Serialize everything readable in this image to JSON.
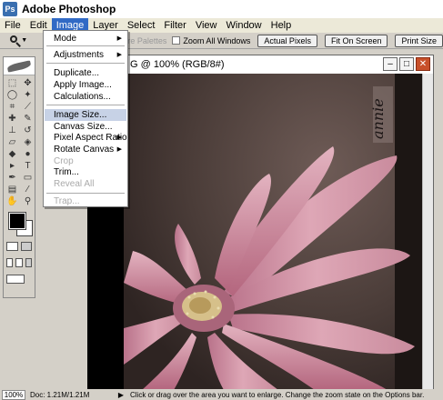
{
  "app": {
    "title": "Adobe Photoshop"
  },
  "menubar": {
    "items": [
      "File",
      "Edit",
      "Image",
      "Layer",
      "Select",
      "Filter",
      "View",
      "Window",
      "Help"
    ],
    "active": "Image"
  },
  "options": {
    "zoom_tool": "zoom-icon",
    "checkboxes": [
      {
        "label": "Ignore Palettes",
        "checked": false,
        "enabled": false
      },
      {
        "label": "Zoom All Windows",
        "checked": false,
        "enabled": true
      }
    ],
    "buttons": [
      "Actual Pixels",
      "Fit On Screen",
      "Print Size"
    ]
  },
  "document": {
    "title": "G @ 100% (RGB/8#)",
    "logo_text": "annie"
  },
  "image_menu": {
    "items": [
      {
        "label": "Mode",
        "submenu": true,
        "enabled": true,
        "highlight": false
      },
      {
        "label": "Adjustments",
        "submenu": true,
        "enabled": true,
        "highlight": false
      },
      {
        "label": "Duplicate...",
        "submenu": false,
        "enabled": true,
        "highlight": false
      },
      {
        "label": "Apply Image...",
        "submenu": false,
        "enabled": true,
        "highlight": false
      },
      {
        "label": "Calculations...",
        "submenu": false,
        "enabled": true,
        "highlight": false
      },
      {
        "label": "Image Size...",
        "submenu": false,
        "enabled": true,
        "highlight": true
      },
      {
        "label": "Canvas Size...",
        "submenu": false,
        "enabled": true,
        "highlight": false
      },
      {
        "label": "Pixel Aspect Ratio",
        "submenu": true,
        "enabled": true,
        "highlight": false
      },
      {
        "label": "Rotate Canvas",
        "submenu": true,
        "enabled": true,
        "highlight": false
      },
      {
        "label": "Crop",
        "submenu": false,
        "enabled": false,
        "highlight": false
      },
      {
        "label": "Trim...",
        "submenu": false,
        "enabled": true,
        "highlight": false
      },
      {
        "label": "Reveal All",
        "submenu": false,
        "enabled": false,
        "highlight": false
      },
      {
        "label": "Trap...",
        "submenu": false,
        "enabled": false,
        "highlight": false
      }
    ]
  },
  "status": {
    "zoom": "100%",
    "doc": "Doc: 1.21M/1.21M",
    "hint": "Click or drag over the area you want to enlarge. Change the zoom state on the Options bar."
  },
  "colors": {
    "menu_highlight": "#c7d2e6",
    "active_menu": "#316ac5",
    "flower_pink": "#d89aa8",
    "background_brown": "#5a4a44"
  }
}
